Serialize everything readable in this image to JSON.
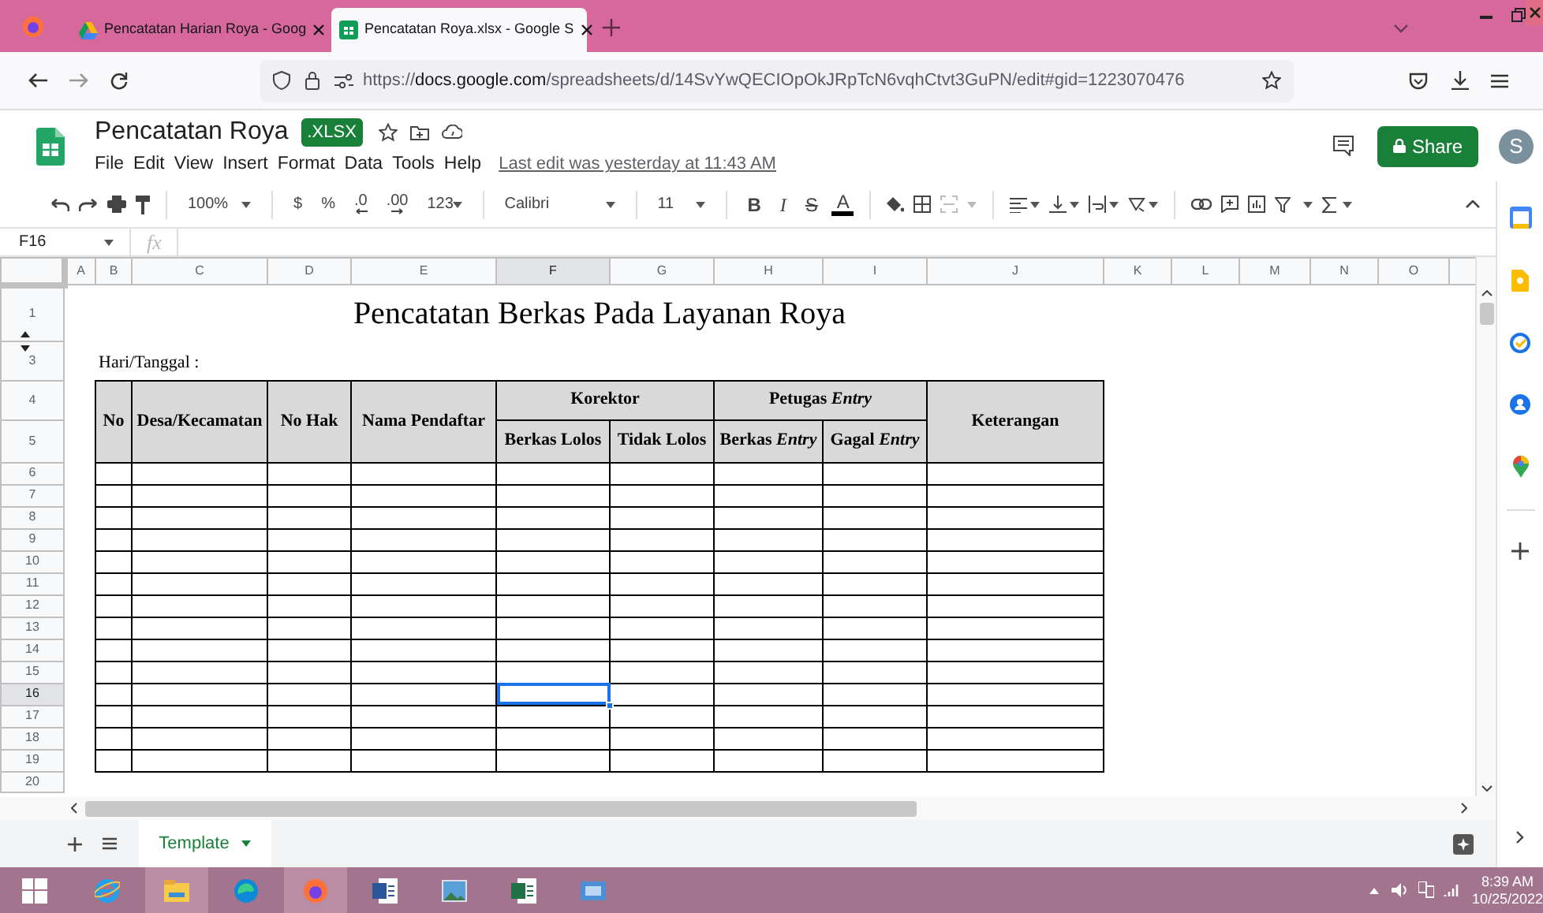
{
  "browser": {
    "tabs": [
      {
        "title": "Pencatatan Harian Roya - Goog",
        "selected": false
      },
      {
        "title": "Pencatatan Roya.xlsx - Google S",
        "selected": true
      }
    ],
    "url": {
      "scheme": "https://",
      "host": "docs.google.com",
      "path": "/spreadsheets/d/14SvYwQECIOpOkJRpTcN6vqhCtvt3GuPN/edit#gid=1223070476"
    }
  },
  "doc": {
    "title": "Pencatatan Roya",
    "badge": ".XLSX",
    "menu": [
      "File",
      "Edit",
      "View",
      "Insert",
      "Format",
      "Data",
      "Tools",
      "Help"
    ],
    "last_edit": "Last edit was yesterday at 11:43 AM",
    "share": "Share",
    "avatar": "S"
  },
  "toolbar": {
    "zoom": "100%",
    "currency": "$",
    "percent": "%",
    "decrease_decimal": ".0",
    "increase_decimal": ".00",
    "number_format": "123",
    "font": "Calibri",
    "font_size": "11",
    "bold": "B",
    "italic": "I",
    "strikethrough": "S",
    "text_color": "A"
  },
  "formula_bar": {
    "cell": "F16",
    "fx": "fx"
  },
  "sheet": {
    "columns": [
      {
        "label": "A",
        "selected": false
      },
      {
        "label": "B",
        "selected": false
      },
      {
        "label": "C",
        "selected": false
      },
      {
        "label": "D",
        "selected": false
      },
      {
        "label": "E",
        "selected": false
      },
      {
        "label": "F",
        "selected": true
      },
      {
        "label": "G",
        "selected": false
      },
      {
        "label": "H",
        "selected": false
      },
      {
        "label": "I",
        "selected": false
      },
      {
        "label": "J",
        "selected": false
      },
      {
        "label": "K",
        "selected": false
      },
      {
        "label": "L",
        "selected": false
      },
      {
        "label": "M",
        "selected": false
      },
      {
        "label": "N",
        "selected": false
      },
      {
        "label": "O",
        "selected": false
      }
    ],
    "rows": [
      {
        "label": "1",
        "selected": false
      },
      {
        "label": "3",
        "selected": false
      },
      {
        "label": "4",
        "selected": false
      },
      {
        "label": "5",
        "selected": false
      },
      {
        "label": "6",
        "selected": false
      },
      {
        "label": "7",
        "selected": false
      },
      {
        "label": "8",
        "selected": false
      },
      {
        "label": "9",
        "selected": false
      },
      {
        "label": "10",
        "selected": false
      },
      {
        "label": "11",
        "selected": false
      },
      {
        "label": "12",
        "selected": false
      },
      {
        "label": "13",
        "selected": false
      },
      {
        "label": "14",
        "selected": false
      },
      {
        "label": "15",
        "selected": false
      },
      {
        "label": "16",
        "selected": true
      },
      {
        "label": "17",
        "selected": false
      },
      {
        "label": "18",
        "selected": false
      },
      {
        "label": "19",
        "selected": false
      },
      {
        "label": "20",
        "selected": false
      }
    ],
    "title": "Pencatatan Berkas Pada Layanan Roya",
    "date_label": "Hari/Tanggal :",
    "headers": [
      {
        "text": "No"
      },
      {
        "text": "Desa/Kecamatan"
      },
      {
        "text": "No Hak"
      },
      {
        "text": "Nama Pendaftar"
      },
      {
        "text": "Korektor",
        "children": [
          {
            "text": "Berkas Lolos"
          },
          {
            "text": "Tidak Lolos"
          }
        ]
      },
      {
        "text": "Petugas *Entry*",
        "children": [
          {
            "text": "Berkas *Entry*"
          },
          {
            "text": "Gagal *Entry*"
          }
        ]
      },
      {
        "text": "Keterangan"
      }
    ]
  },
  "sheet_tabs": [
    {
      "label": "Template",
      "selected": true
    }
  ],
  "taskbar": {
    "time": "8:39 AM",
    "date": "10/25/2022"
  }
}
